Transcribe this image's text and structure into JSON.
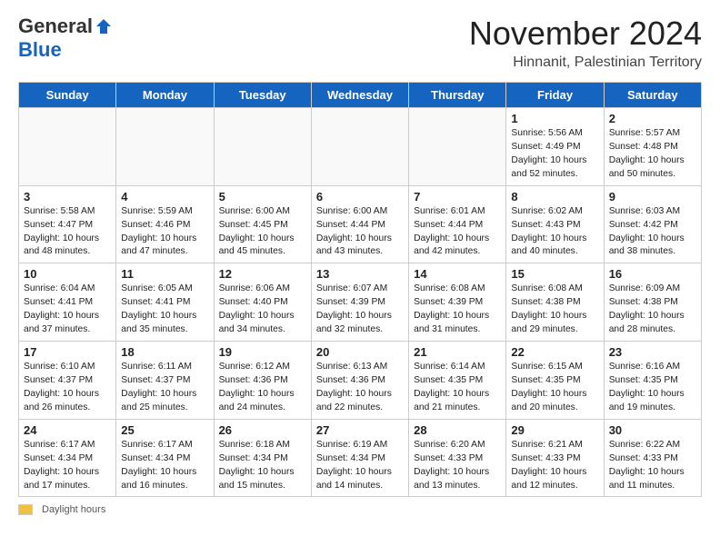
{
  "logo": {
    "general": "General",
    "blue": "Blue"
  },
  "header": {
    "month": "November 2024",
    "location": "Hinnanit, Palestinian Territory"
  },
  "weekdays": [
    "Sunday",
    "Monday",
    "Tuesday",
    "Wednesday",
    "Thursday",
    "Friday",
    "Saturday"
  ],
  "weeks": [
    [
      {
        "day": "",
        "info": ""
      },
      {
        "day": "",
        "info": ""
      },
      {
        "day": "",
        "info": ""
      },
      {
        "day": "",
        "info": ""
      },
      {
        "day": "",
        "info": ""
      },
      {
        "day": "1",
        "info": "Sunrise: 5:56 AM\nSunset: 4:49 PM\nDaylight: 10 hours and 52 minutes."
      },
      {
        "day": "2",
        "info": "Sunrise: 5:57 AM\nSunset: 4:48 PM\nDaylight: 10 hours and 50 minutes."
      }
    ],
    [
      {
        "day": "3",
        "info": "Sunrise: 5:58 AM\nSunset: 4:47 PM\nDaylight: 10 hours and 48 minutes."
      },
      {
        "day": "4",
        "info": "Sunrise: 5:59 AM\nSunset: 4:46 PM\nDaylight: 10 hours and 47 minutes."
      },
      {
        "day": "5",
        "info": "Sunrise: 6:00 AM\nSunset: 4:45 PM\nDaylight: 10 hours and 45 minutes."
      },
      {
        "day": "6",
        "info": "Sunrise: 6:00 AM\nSunset: 4:44 PM\nDaylight: 10 hours and 43 minutes."
      },
      {
        "day": "7",
        "info": "Sunrise: 6:01 AM\nSunset: 4:44 PM\nDaylight: 10 hours and 42 minutes."
      },
      {
        "day": "8",
        "info": "Sunrise: 6:02 AM\nSunset: 4:43 PM\nDaylight: 10 hours and 40 minutes."
      },
      {
        "day": "9",
        "info": "Sunrise: 6:03 AM\nSunset: 4:42 PM\nDaylight: 10 hours and 38 minutes."
      }
    ],
    [
      {
        "day": "10",
        "info": "Sunrise: 6:04 AM\nSunset: 4:41 PM\nDaylight: 10 hours and 37 minutes."
      },
      {
        "day": "11",
        "info": "Sunrise: 6:05 AM\nSunset: 4:41 PM\nDaylight: 10 hours and 35 minutes."
      },
      {
        "day": "12",
        "info": "Sunrise: 6:06 AM\nSunset: 4:40 PM\nDaylight: 10 hours and 34 minutes."
      },
      {
        "day": "13",
        "info": "Sunrise: 6:07 AM\nSunset: 4:39 PM\nDaylight: 10 hours and 32 minutes."
      },
      {
        "day": "14",
        "info": "Sunrise: 6:08 AM\nSunset: 4:39 PM\nDaylight: 10 hours and 31 minutes."
      },
      {
        "day": "15",
        "info": "Sunrise: 6:08 AM\nSunset: 4:38 PM\nDaylight: 10 hours and 29 minutes."
      },
      {
        "day": "16",
        "info": "Sunrise: 6:09 AM\nSunset: 4:38 PM\nDaylight: 10 hours and 28 minutes."
      }
    ],
    [
      {
        "day": "17",
        "info": "Sunrise: 6:10 AM\nSunset: 4:37 PM\nDaylight: 10 hours and 26 minutes."
      },
      {
        "day": "18",
        "info": "Sunrise: 6:11 AM\nSunset: 4:37 PM\nDaylight: 10 hours and 25 minutes."
      },
      {
        "day": "19",
        "info": "Sunrise: 6:12 AM\nSunset: 4:36 PM\nDaylight: 10 hours and 24 minutes."
      },
      {
        "day": "20",
        "info": "Sunrise: 6:13 AM\nSunset: 4:36 PM\nDaylight: 10 hours and 22 minutes."
      },
      {
        "day": "21",
        "info": "Sunrise: 6:14 AM\nSunset: 4:35 PM\nDaylight: 10 hours and 21 minutes."
      },
      {
        "day": "22",
        "info": "Sunrise: 6:15 AM\nSunset: 4:35 PM\nDaylight: 10 hours and 20 minutes."
      },
      {
        "day": "23",
        "info": "Sunrise: 6:16 AM\nSunset: 4:35 PM\nDaylight: 10 hours and 19 minutes."
      }
    ],
    [
      {
        "day": "24",
        "info": "Sunrise: 6:17 AM\nSunset: 4:34 PM\nDaylight: 10 hours and 17 minutes."
      },
      {
        "day": "25",
        "info": "Sunrise: 6:17 AM\nSunset: 4:34 PM\nDaylight: 10 hours and 16 minutes."
      },
      {
        "day": "26",
        "info": "Sunrise: 6:18 AM\nSunset: 4:34 PM\nDaylight: 10 hours and 15 minutes."
      },
      {
        "day": "27",
        "info": "Sunrise: 6:19 AM\nSunset: 4:34 PM\nDaylight: 10 hours and 14 minutes."
      },
      {
        "day": "28",
        "info": "Sunrise: 6:20 AM\nSunset: 4:33 PM\nDaylight: 10 hours and 13 minutes."
      },
      {
        "day": "29",
        "info": "Sunrise: 6:21 AM\nSunset: 4:33 PM\nDaylight: 10 hours and 12 minutes."
      },
      {
        "day": "30",
        "info": "Sunrise: 6:22 AM\nSunset: 4:33 PM\nDaylight: 10 hours and 11 minutes."
      }
    ]
  ],
  "footer": {
    "legend_label": "Daylight hours"
  }
}
